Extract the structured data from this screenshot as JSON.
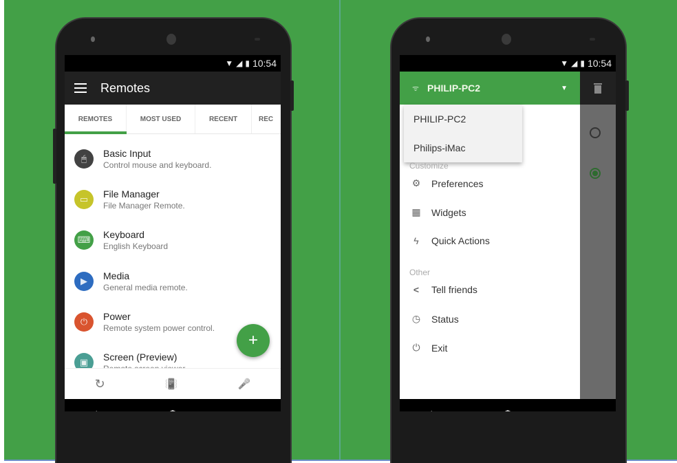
{
  "status_bar": {
    "time": "10:54"
  },
  "left_screen": {
    "app_title": "Remotes",
    "tabs": [
      {
        "label": "REMOTES",
        "active": true
      },
      {
        "label": "MOST USED",
        "active": false
      },
      {
        "label": "RECENT",
        "active": false
      },
      {
        "label": "REC",
        "active": false
      }
    ],
    "remotes": [
      {
        "title": "Basic Input",
        "subtitle": "Control mouse and keyboard.",
        "icon": "mouse-icon",
        "color": "#424242",
        "glyph": "🖱"
      },
      {
        "title": "File Manager",
        "subtitle": "File Manager Remote.",
        "icon": "folder-icon",
        "color": "#c6c42a",
        "glyph": "▭"
      },
      {
        "title": "Keyboard",
        "subtitle": "English Keyboard",
        "icon": "keyboard-icon",
        "color": "#43a047",
        "glyph": "⌨"
      },
      {
        "title": "Media",
        "subtitle": "General media remote.",
        "icon": "media-icon",
        "color": "#2d6cc0",
        "glyph": "▶"
      },
      {
        "title": "Power",
        "subtitle": "Remote system power control.",
        "icon": "power-icon",
        "color": "#d9542f",
        "glyph": "⏻"
      },
      {
        "title": "Screen (Preview)",
        "subtitle": "Remote screen viewer",
        "icon": "monitor-icon",
        "color": "#4a9e94",
        "glyph": "▣"
      }
    ],
    "fab_label": "+",
    "bottom_bar": {
      "refresh": "↻",
      "vibrate": "📳",
      "mic": "🎤"
    }
  },
  "right_screen": {
    "server": "PHILIP-PC2",
    "servers": [
      "PHILIP-PC2",
      "Philips-iMac"
    ],
    "sections": [
      {
        "header": "Customize",
        "items": [
          {
            "label": "Preferences",
            "glyph": "⚙"
          },
          {
            "label": "Widgets",
            "glyph": "▦"
          },
          {
            "label": "Quick Actions",
            "glyph": "ϟ"
          }
        ]
      },
      {
        "header": "Other",
        "items": [
          {
            "label": "Tell friends",
            "glyph": "<"
          },
          {
            "label": "Status",
            "glyph": "◷"
          },
          {
            "label": "Exit",
            "glyph": "⏻"
          }
        ]
      }
    ],
    "background_radios": [
      {
        "selected": false
      },
      {
        "selected": true
      }
    ]
  }
}
